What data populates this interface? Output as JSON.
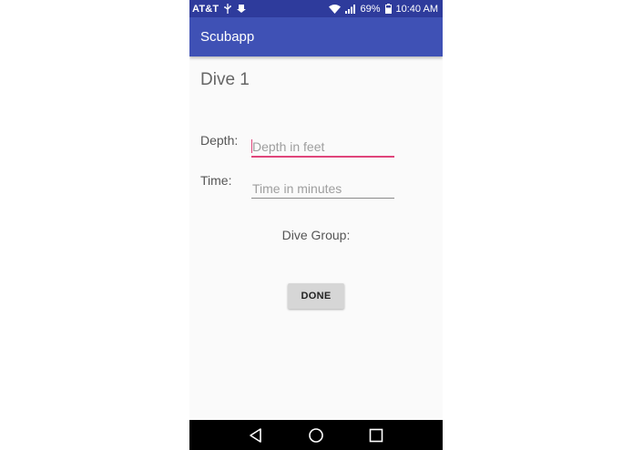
{
  "status_bar": {
    "carrier": "AT&T",
    "battery": "69%",
    "time": "10:40 AM",
    "icons": [
      "usb-icon",
      "download-icon",
      "wifi-icon",
      "signal-icon",
      "battery-icon"
    ]
  },
  "app_bar": {
    "title": "Scubapp",
    "color": "#3f51b5"
  },
  "form": {
    "heading": "Dive 1",
    "depth_label": "Depth:",
    "depth_placeholder": "Depth in feet",
    "depth_value": "",
    "time_label": "Time:",
    "time_placeholder": "Time in minutes",
    "time_value": "",
    "dive_group_label": "Dive Group:",
    "accent_color": "#e0457b"
  },
  "actions": {
    "done_label": "DONE"
  },
  "nav_bar": {
    "buttons": [
      "back-icon",
      "home-icon",
      "recents-icon"
    ]
  }
}
